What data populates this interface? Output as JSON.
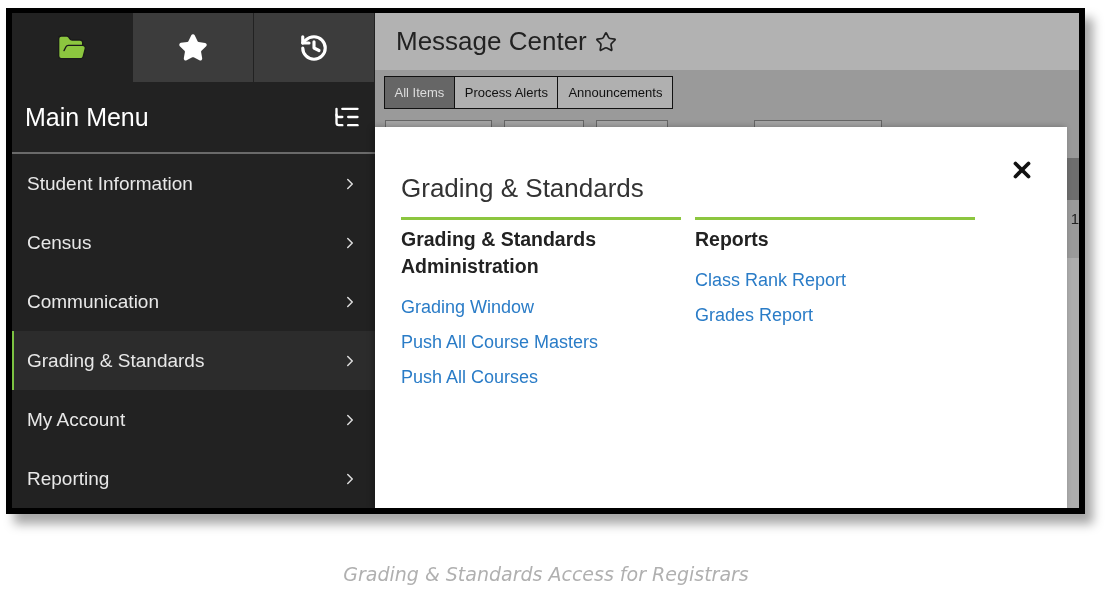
{
  "sidebar": {
    "tabs": [
      {
        "kind": "folder",
        "selected": true
      },
      {
        "kind": "star",
        "selected": false
      },
      {
        "kind": "history",
        "selected": false
      }
    ],
    "title": "Main Menu",
    "items": [
      {
        "label": "Student Information",
        "selected": false
      },
      {
        "label": "Census",
        "selected": false
      },
      {
        "label": "Communication",
        "selected": false
      },
      {
        "label": "Grading & Standards",
        "selected": true
      },
      {
        "label": "My Account",
        "selected": false
      },
      {
        "label": "Reporting",
        "selected": false
      }
    ]
  },
  "page": {
    "title": "Message Center",
    "tabs": [
      {
        "label": "All Items",
        "selected": true
      },
      {
        "label": "Process Alerts",
        "selected": false
      },
      {
        "label": "Announcements",
        "selected": false
      }
    ],
    "column_edge_text": "1"
  },
  "modal": {
    "title": "Grading & Standards",
    "columns": [
      {
        "heading": "Grading & Standards Administration",
        "links": [
          "Grading Window",
          "Push All Course Masters",
          "Push All Courses"
        ]
      },
      {
        "heading": "Reports",
        "links": [
          "Class Rank Report",
          "Grades Report"
        ]
      }
    ]
  },
  "caption": "Grading & Standards Access for Registrars"
}
